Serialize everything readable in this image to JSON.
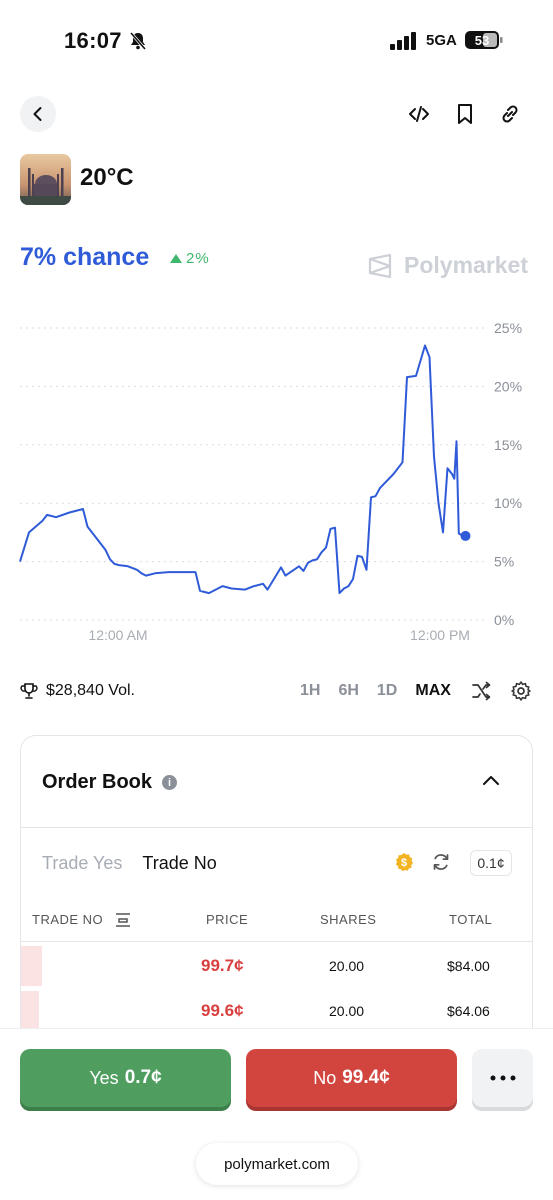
{
  "status_bar": {
    "time": "16:07",
    "network": "5GA",
    "battery": "53"
  },
  "market": {
    "title": "20°C",
    "chance": "7% chance",
    "delta": "2%",
    "brand": "Polymarket"
  },
  "chart_data": {
    "type": "line",
    "x_tick_labels": [
      "12:00 AM",
      "12:00 PM"
    ],
    "y_tick_labels": [
      "25%",
      "20%",
      "15%",
      "10%",
      "5%",
      "0%"
    ],
    "ylim": [
      0,
      25
    ],
    "grid": true,
    "line_color": "#2f5bd8",
    "series": [
      {
        "x": [
          0,
          2,
          5,
          6,
          8,
          11,
          14,
          15,
          17,
          19,
          20,
          21,
          22,
          24,
          26,
          27,
          28,
          30,
          33,
          37,
          39,
          40,
          41,
          42,
          45,
          47,
          50,
          52,
          54,
          55,
          58,
          59,
          62,
          63,
          64,
          65,
          66,
          67,
          68,
          69,
          70,
          71,
          72,
          73,
          74,
          75,
          76,
          77,
          78,
          79,
          80,
          81,
          83,
          85,
          86,
          88,
          90,
          91,
          92,
          93,
          94,
          95,
          96,
          96.5,
          97,
          97.5,
          98,
          98.5,
          99
        ],
        "values": [
          5,
          7.5,
          8.5,
          9,
          8.8,
          9.2,
          9.5,
          8,
          7,
          6,
          5.2,
          4.8,
          4.7,
          4.6,
          4.3,
          4,
          3.8,
          4,
          4.1,
          4.1,
          4.1,
          2.5,
          2.4,
          2.3,
          2.9,
          2.7,
          2.6,
          2.9,
          3.1,
          2.6,
          4.5,
          3.8,
          4.6,
          4.2,
          4.9,
          5.1,
          5.2,
          5.8,
          6.2,
          7.8,
          7.9,
          2.3,
          2.7,
          2.9,
          3.5,
          5.5,
          5.4,
          4.3,
          10.5,
          10.6,
          11.3,
          11.7,
          12.5,
          13.5,
          20.8,
          20.9,
          23.5,
          22.5,
          14,
          10,
          7.5,
          13,
          12.5,
          12.1,
          15.3,
          7.4,
          7.3,
          7.2,
          7.2
        ]
      }
    ]
  },
  "volume": {
    "label": "$28,840 Vol."
  },
  "ranges": [
    "1H",
    "6H",
    "1D",
    "MAX"
  ],
  "order_book": {
    "title": "Order Book",
    "info": "i",
    "tab_yes": "Trade Yes",
    "tab_no": "Trade No",
    "tick": "0.1¢",
    "columns": [
      "TRADE NO",
      "PRICE",
      "SHARES",
      "TOTAL"
    ],
    "rows": [
      {
        "price": "99.7¢",
        "shares": "20.00",
        "total": "$84.00",
        "depth": 0.04
      },
      {
        "price": "99.6¢",
        "shares": "20.00",
        "total": "$64.06",
        "depth": 0.035
      }
    ]
  },
  "actions": {
    "yes_label": "Yes",
    "yes_price": "0.7¢",
    "no_label": "No",
    "no_price": "99.4¢",
    "url": "polymarket.com"
  }
}
